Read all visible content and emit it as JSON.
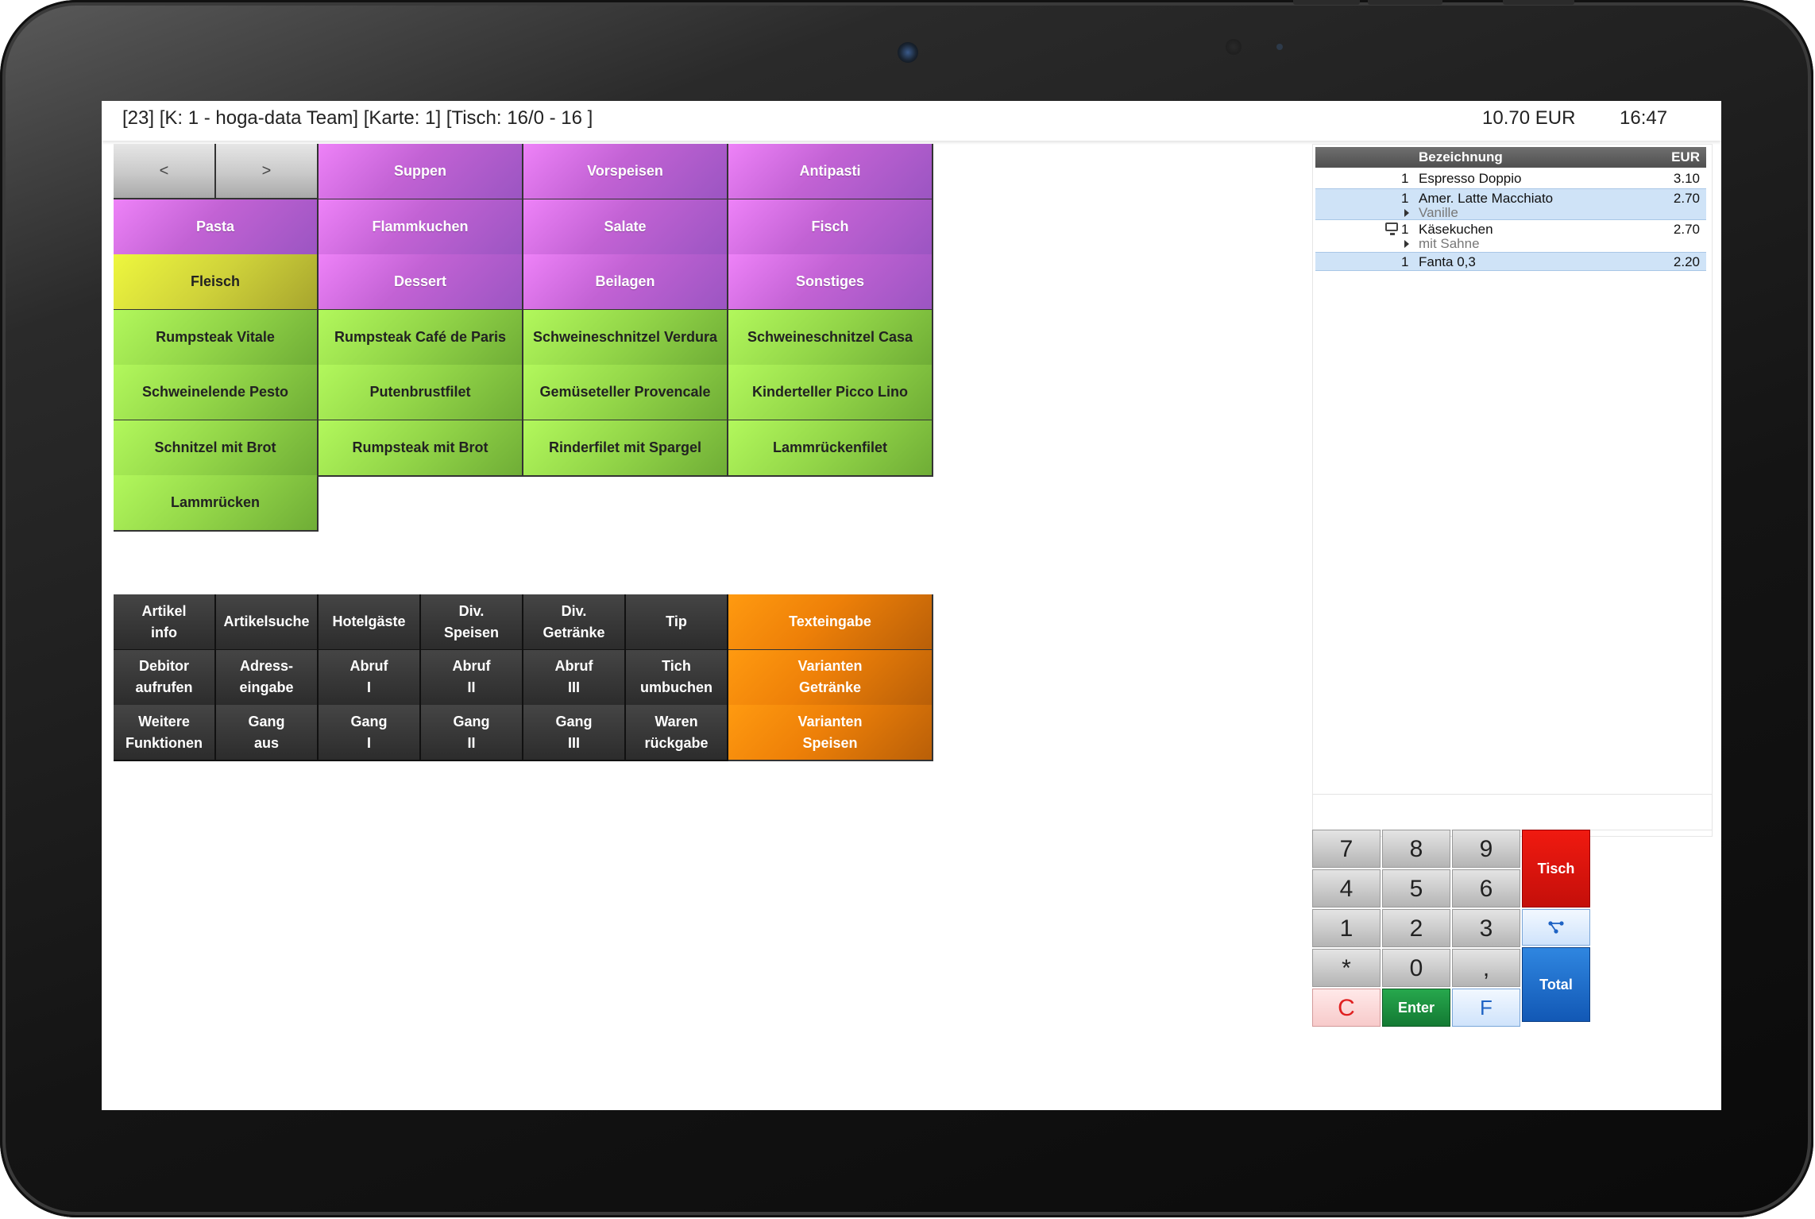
{
  "titlebar": {
    "info": "[23] [K: 1 - hoga-data Team] [Karte: 1] [Tisch: 16/0 - 16 ]",
    "total": "10.70 EUR",
    "time": "16:47"
  },
  "nav": {
    "prev": "<",
    "next": ">"
  },
  "categories": [
    "Suppen",
    "Vorspeisen",
    "Antipasti",
    "Pasta",
    "Flammkuchen",
    "Salate",
    "Fisch",
    "Fleisch",
    "Dessert",
    "Beilagen",
    "Sonstiges"
  ],
  "articles": [
    "Rumpsteak Vitale",
    "Rumpsteak Café de Paris",
    "Schweineschnitzel Verdura",
    "Schweineschnitzel Casa",
    "Schweinelende Pesto",
    "Putenbrustfilet",
    "Gemüseteller Provencale",
    "Kinderteller Picco Lino",
    "Schnitzel mit Brot",
    "Rumpsteak mit Brot",
    "Rinderfilet mit Spargel",
    "Lammrückenfilet",
    "Lammrücken"
  ],
  "functions": [
    "Artikel\ninfo",
    "Artikelsuche",
    "Hotelgäste",
    "Div.\nSpeisen",
    "Div.\nGetränke",
    "Tip",
    "Debitor\naufrufen",
    "Adress-\neingabe",
    "Abruf\nI",
    "Abruf\nII",
    "Abruf\nIII",
    "Tich\numbuchen",
    "Weitere\nFunktionen",
    "Gang\naus",
    "Gang\nI",
    "Gang\nII",
    "Gang\nIII",
    "Waren\nrückgabe"
  ],
  "orange_buttons": [
    "Texteingabe",
    "Varianten\nGetränke",
    "Varianten\nSpeisen"
  ],
  "order": {
    "header": {
      "name": "Bezeichnung",
      "price": "EUR"
    },
    "items": [
      {
        "qty": "1",
        "name": "Espresso Doppio",
        "price": "3.10",
        "modifier": ""
      },
      {
        "qty": "1",
        "name": "Amer. Latte Macchiato",
        "price": "2.70",
        "modifier": "Vanille"
      },
      {
        "qty": "1",
        "name": "Käsekuchen",
        "price": "2.70",
        "modifier": "mit Sahne"
      },
      {
        "qty": "1",
        "name": "Fanta 0,3",
        "price": "2.20",
        "modifier": ""
      }
    ]
  },
  "keypad": {
    "digits": [
      "7",
      "8",
      "9",
      "4",
      "5",
      "6",
      "1",
      "2",
      "3",
      "*",
      "0",
      ","
    ],
    "tisch": "Tisch",
    "total": "Total",
    "clear": "C",
    "enter": "Enter",
    "f": "F"
  },
  "colors": {
    "category": "#c262d4",
    "active_category": "#cfd23a",
    "article": "#92d548",
    "function": "#2c2c2c",
    "variant": "#ee8008",
    "tisch": "#d4120c",
    "total": "#1a6ac8"
  },
  "icons": {
    "split": "split-icon",
    "monitor": "monitor-icon",
    "modifier": "triangle-right-icon"
  }
}
